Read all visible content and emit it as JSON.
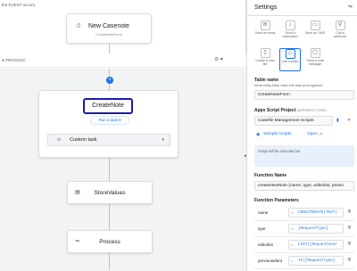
{
  "canvas": {
    "event_label": "the EVENT occurs:",
    "process_label": "● PROCESS:",
    "top_node": {
      "title": "New Casenote",
      "subtitle": "CreateNoteForm",
      "icon": "shuffle-icon"
    },
    "main_node": {
      "title": "CreateNote",
      "run_button": "Run a task",
      "task_select": "Custom task"
    },
    "store_node": {
      "title": "StoreValues",
      "icon": "table-icon"
    },
    "process_node": {
      "title": "Process",
      "icon": "arrow-icon"
    }
  },
  "panel": {
    "title": "Settings",
    "header_button": "⇋",
    "tiles": [
      {
        "label": "Send an email",
        "icon": "mail-icon",
        "active": false
      },
      {
        "label": "Send a notification",
        "icon": "bell-icon",
        "active": false
      },
      {
        "label": "Send an SMS",
        "icon": "sms-icon",
        "active": false
      },
      {
        "label": "Call a webhook",
        "icon": "webhook-icon",
        "active": false
      },
      {
        "label": "Create a new file",
        "icon": "file-icon",
        "active": false
      },
      {
        "label": "Call a script",
        "icon": "script-icon",
        "active": true
      },
      {
        "label": "Send a chat message",
        "icon": "chat-icon",
        "active": false
      }
    ],
    "table_name": {
      "label": "Table name",
      "hint": "What entity table does this task work against?",
      "value": "CreateNoteForm"
    },
    "project": {
      "label": "Apps Script Project",
      "badge": "(APPSHEET CORE)",
      "value": "Casefile Management Scripts",
      "sample_link": "Sample scripts",
      "open_link": "Open"
    },
    "exec_note": "Script will be executed as",
    "function_name": {
      "label": "Function Name",
      "value": "createNewNote (name, type, editorlist, previo"
    },
    "function_params": {
      "label": "Function Parameters",
      "rows": [
        {
          "name": "name",
          "value": "CONCATENATE(TEXT("
        },
        {
          "name": "type",
          "value": "[RequestType]"
        },
        {
          "name": "editorlist",
          "value": "LIST([RequestUser"
        },
        {
          "name": "previousIdent",
          "value": "IF([RequestType]"
        }
      ]
    }
  }
}
